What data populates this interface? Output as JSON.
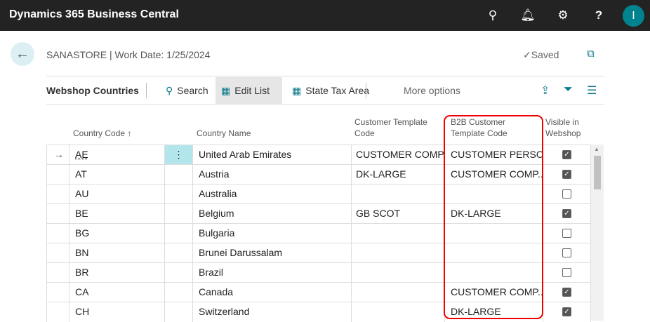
{
  "app": {
    "title": "Dynamics 365 Business Central",
    "avatar": "I"
  },
  "header": {
    "breadcrumb": "SANASTORE | Work Date: 1/25/2024",
    "saved": "✓Saved"
  },
  "actions": {
    "page_name": "Webshop Countries",
    "search": "Search",
    "edit_list": "Edit List",
    "state_tax": "State Tax Area",
    "more": "More options"
  },
  "columns": {
    "code": "Country Code ↑",
    "name": "Country Name",
    "template": "Customer Template Code",
    "b2b": "B2B Customer Template Code",
    "visible": "Visible in Webshop"
  },
  "rows": [
    {
      "code": "AE",
      "name": "United Arab Emirates",
      "template": "CUSTOMER COMP...",
      "b2b": "CUSTOMER PERSON",
      "visible": true
    },
    {
      "code": "AT",
      "name": "Austria",
      "template": "DK-LARGE",
      "b2b": "CUSTOMER COMP...",
      "visible": true
    },
    {
      "code": "AU",
      "name": "Australia",
      "template": "",
      "b2b": "",
      "visible": false
    },
    {
      "code": "BE",
      "name": "Belgium",
      "template": "GB SCOT",
      "b2b": "DK-LARGE",
      "visible": true
    },
    {
      "code": "BG",
      "name": "Bulgaria",
      "template": "",
      "b2b": "",
      "visible": false
    },
    {
      "code": "BN",
      "name": "Brunei Darussalam",
      "template": "",
      "b2b": "",
      "visible": false
    },
    {
      "code": "BR",
      "name": "Brazil",
      "template": "",
      "b2b": "",
      "visible": false
    },
    {
      "code": "CA",
      "name": "Canada",
      "template": "",
      "b2b": "CUSTOMER COMP...",
      "visible": true
    },
    {
      "code": "CH",
      "name": "Switzerland",
      "template": "",
      "b2b": "DK-LARGE",
      "visible": true
    }
  ],
  "colors": {
    "accent": "#0a7a8a",
    "highlight": "#e00000",
    "topbar": "#232323"
  }
}
